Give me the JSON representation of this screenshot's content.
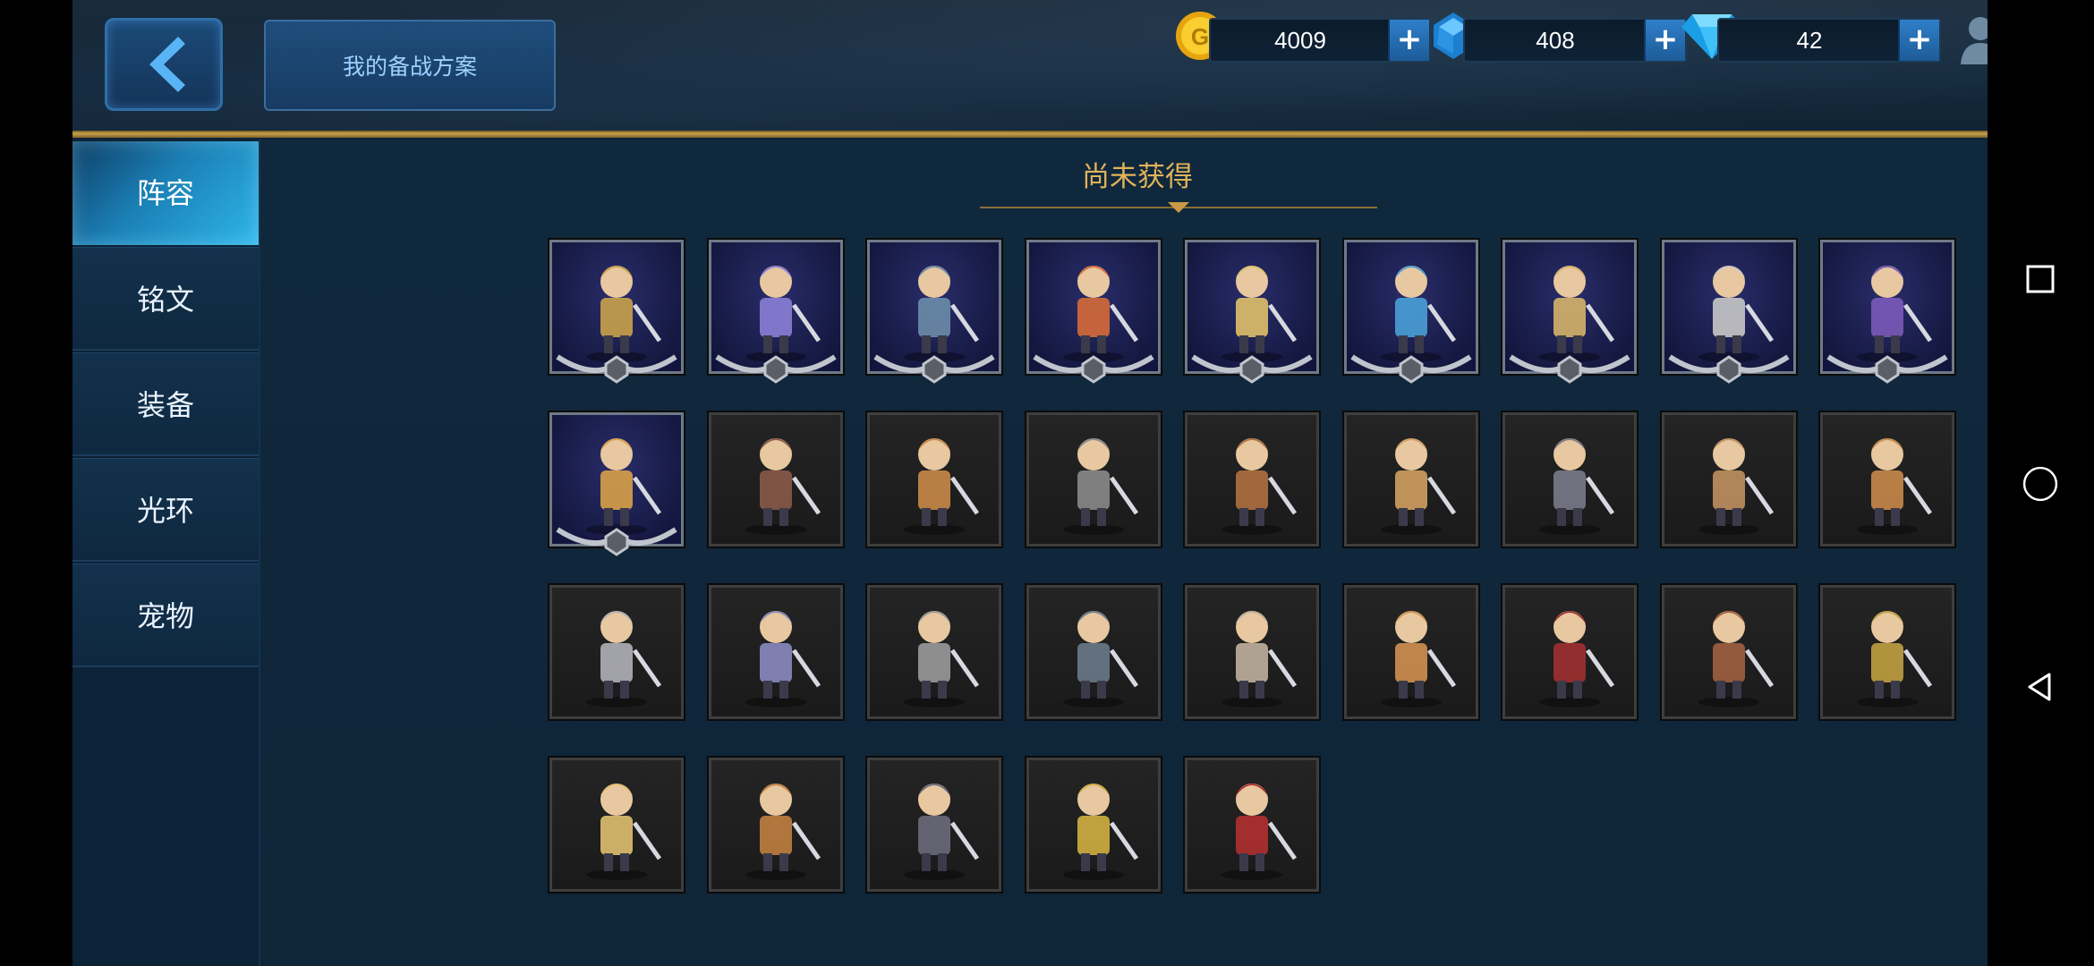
{
  "header": {
    "plan_label": "我的备战方案",
    "currencies": [
      {
        "name": "gold",
        "value": "4009",
        "color": "#f5c21a"
      },
      {
        "name": "crystal",
        "value": "408",
        "color": "#3aa0e6"
      },
      {
        "name": "diamond",
        "value": "42",
        "color": "#3ac4f4"
      }
    ],
    "plus_label": "+"
  },
  "sidebar": {
    "items": [
      {
        "label": "阵容",
        "active": true
      },
      {
        "label": "铭文",
        "active": false
      },
      {
        "label": "装备",
        "active": false
      },
      {
        "label": "光环",
        "active": false
      },
      {
        "label": "宠物",
        "active": false
      }
    ]
  },
  "main": {
    "section_title": "尚未获得",
    "heroes_owned_count": 10,
    "heroes_total": 32
  },
  "colors": {
    "accent_gold": "#e0b35a",
    "panel_blue": "#0f2538",
    "active_tab": "#2fb6e8"
  }
}
